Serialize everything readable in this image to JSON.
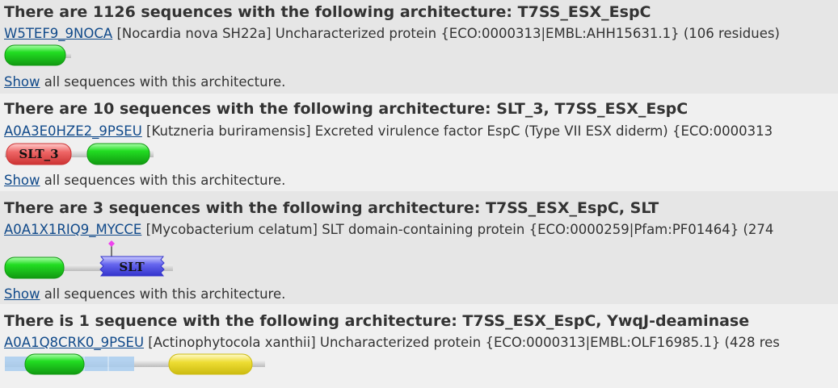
{
  "blocks": [
    {
      "title": "There are 1126 sequences with the following architecture: T7SS_ESX_EspC",
      "seq_link": "W5TEF9_9NOCA",
      "seq_desc": " [Nocardia nova SH22a] Uncharacterized protein {ECO:0000313|EMBL:AHH15631.1} (106 residues)",
      "show_link": "Show",
      "show_text": " all sequences with this architecture."
    },
    {
      "title": "There are 10 sequences with the following architecture: SLT_3, T7SS_ESX_EspC",
      "seq_link": "A0A3E0HZE2_9PSEU",
      "seq_desc": " [Kutzneria buriramensis] Excreted virulence factor EspC (Type VII ESX diderm) {ECO:0000313",
      "show_link": "Show",
      "show_text": " all sequences with this architecture.",
      "domain_label": "SLT_3"
    },
    {
      "title": "There are 3 sequences with the following architecture: T7SS_ESX_EspC, SLT",
      "seq_link": "A0A1X1RIQ9_MYCCE",
      "seq_desc": " [Mycobacterium celatum] SLT domain-containing protein {ECO:0000259|Pfam:PF01464} (274",
      "show_link": "Show",
      "show_text": " all sequences with this architecture.",
      "domain_label": "SLT"
    },
    {
      "title": "There is 1 sequence with the following architecture: T7SS_ESX_EspC, YwqJ-deaminase",
      "seq_link": "A0A1Q8CRK0_9PSEU",
      "seq_desc": " [Actinophytocola xanthii] Uncharacterized protein {ECO:0000313|EMBL:OLF16985.1} (428 res"
    }
  ],
  "colors": {
    "espc_green": "#22cc22",
    "slt3_red": "#ee5555",
    "slt_blue": "#5555ee",
    "ywqj_yellow": "#eedd22",
    "disorder_blue": "#a8ccee",
    "link_blue": "#114a8a",
    "site_magenta": "#ee44ee"
  }
}
